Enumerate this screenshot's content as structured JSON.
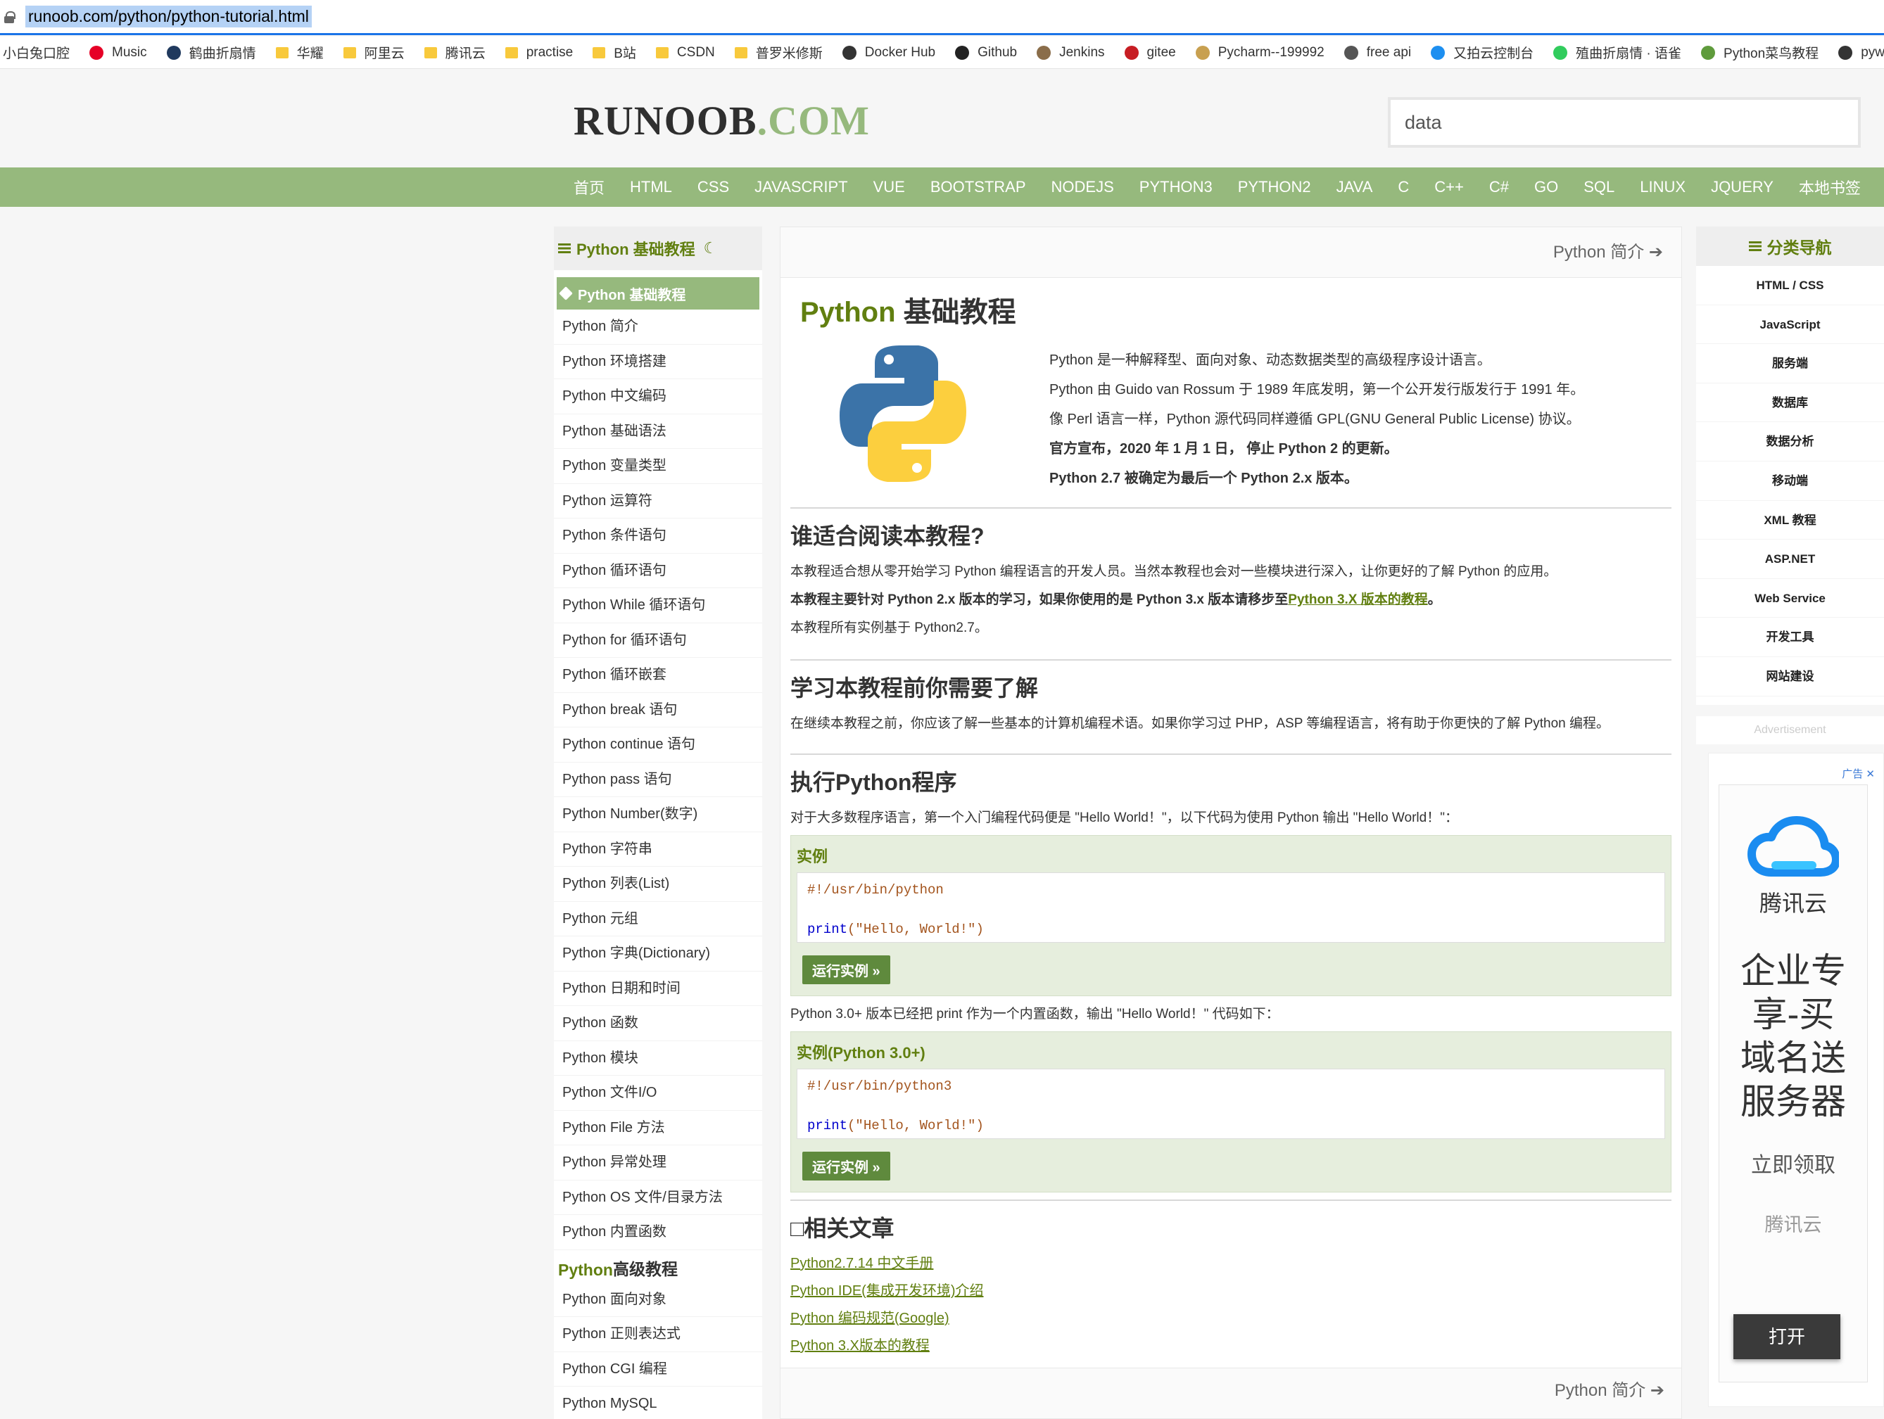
{
  "browser": {
    "url": "runoob.com/python/python-tutorial.html",
    "bookmarks": [
      {
        "label": "小白兔口腔",
        "icon": "none",
        "color": ""
      },
      {
        "label": "Music",
        "icon": "netease-music-icon",
        "color": "#e60026"
      },
      {
        "label": "鹤曲折扇情",
        "icon": "image-icon",
        "color": "#203a5e"
      },
      {
        "label": "华耀",
        "icon": "folder-icon",
        "color": "#f8c93c"
      },
      {
        "label": "阿里云",
        "icon": "folder-icon",
        "color": "#f8c93c"
      },
      {
        "label": "腾讯云",
        "icon": "folder-icon",
        "color": "#f8c93c"
      },
      {
        "label": "practise",
        "icon": "folder-icon",
        "color": "#f8c93c"
      },
      {
        "label": "B站",
        "icon": "folder-icon",
        "color": "#f8c93c"
      },
      {
        "label": "CSDN",
        "icon": "folder-icon",
        "color": "#f8c93c"
      },
      {
        "label": "普罗米修斯",
        "icon": "folder-icon",
        "color": "#f8c93c"
      },
      {
        "label": "Docker Hub",
        "icon": "docker-icon",
        "color": "#333333"
      },
      {
        "label": "Github",
        "icon": "github-icon",
        "color": "#222222"
      },
      {
        "label": "Jenkins",
        "icon": "jenkins-icon",
        "color": "#8a6d4a"
      },
      {
        "label": "gitee",
        "icon": "gitee-icon",
        "color": "#c71d23"
      },
      {
        "label": "Pycharm--199992",
        "icon": "user-icon",
        "color": "#c8a050"
      },
      {
        "label": "free api",
        "icon": "globe-icon",
        "color": "#555555"
      },
      {
        "label": "又拍云控制台",
        "icon": "upyun-icon",
        "color": "#1d8ff0"
      },
      {
        "label": "殖曲折扇情 · 语雀",
        "icon": "yuque-icon",
        "color": "#31cc5d"
      },
      {
        "label": "Python菜鸟教程",
        "icon": "runoob-icon",
        "color": "#5f9b3c"
      },
      {
        "label": "pywin",
        "icon": "pywin-icon",
        "color": "#333333"
      }
    ]
  },
  "header": {
    "logo_main": "RUNOOB",
    "logo_dot": ".COM",
    "search_value": "data"
  },
  "nav": [
    "首页",
    "HTML",
    "CSS",
    "JAVASCRIPT",
    "VUE",
    "BOOTSTRAP",
    "NODEJS",
    "PYTHON3",
    "PYTHON2",
    "JAVA",
    "C",
    "C++",
    "C#",
    "GO",
    "SQL",
    "LINUX",
    "JQUERY",
    "本地书签"
  ],
  "left_nav": {
    "head": "Python 基础教程",
    "active": "Python 基础教程",
    "items": [
      "Python 简介",
      "Python 环境搭建",
      "Python 中文编码",
      "Python 基础语法",
      "Python 变量类型",
      "Python 运算符",
      "Python 条件语句",
      "Python 循环语句",
      "Python While 循环语句",
      "Python for 循环语句",
      "Python 循环嵌套",
      "Python break 语句",
      "Python continue 语句",
      "Python pass 语句",
      "Python Number(数字)",
      "Python 字符串",
      "Python 列表(List)",
      "Python 元组",
      "Python 字典(Dictionary)",
      "Python 日期和时间",
      "Python 函数",
      "Python 模块",
      "Python 文件I/O",
      "Python File 方法",
      "Python 异常处理",
      "Python OS 文件/目录方法",
      "Python 内置函数"
    ],
    "advanced_head_green": "Python",
    "advanced_head_rest": " 高级教程",
    "advanced_items": [
      "Python 面向对象",
      "Python 正则表达式",
      "Python CGI 编程",
      "Python MySQL"
    ]
  },
  "main": {
    "next_link": "Python 简介",
    "title_green": "Python",
    "title_rest": " 基础教程",
    "intro": [
      "Python 是一种解释型、面向对象、动态数据类型的高级程序设计语言。",
      "Python 由 Guido van Rossum 于 1989 年底发明，第一个公开发行版发行于 1991 年。",
      "像 Perl 语言一样，Python 源代码同样遵循 GPL(GNU General Public License) 协议。",
      "官方宣布，2020 年 1 月 1 日， 停止 Python 2 的更新。",
      "Python 2.7 被确定为最后一个 Python 2.x 版本。"
    ],
    "s1_title": "谁适合阅读本教程?",
    "s1_p1": "本教程适合想从零开始学习 Python 编程语言的开发人员。当然本教程也会对一些模块进行深入，让你更好的了解 Python 的应用。",
    "s1_p2_pre": "本教程主要针对 Python 2.x 版本的学习，如果你使用的是 Python 3.x 版本请移步至",
    "s1_p2_link": "Python 3.X 版本的教程",
    "s1_p2_post": "。",
    "s1_p3": "本教程所有实例基于 Python2.7。",
    "s2_title": "学习本教程前你需要了解",
    "s2_p": "在继续本教程之前，你应该了解一些基本的计算机编程术语。如果你学习过 PHP，ASP 等编程语言，将有助于你更快的了解 Python 编程。",
    "s3_title": "执行Python程序",
    "s3_p": "对于大多数程序语言，第一个入门编程代码便是 \"Hello World！\"，以下代码为使用 Python 输出 \"Hello World！\"：",
    "ex1_title": "实例",
    "ex1_line1": "#!/usr/bin/python",
    "ex1_kw": "print",
    "ex1_args": "(\"Hello, World!\")",
    "run_label": "运行实例 »",
    "s3_p2": "Python 3.0+ 版本已经把 print 作为一个内置函数，输出 \"Hello World！\" 代码如下：",
    "ex2_title": "实例(Python 3.0+)",
    "ex2_line1": "#!/usr/bin/python3",
    "ex2_kw": "print",
    "ex2_args": "(\"Hello, World!\")",
    "related_title": "相关文章",
    "related": [
      "Python2.7.14 中文手册",
      "Python IDE(集成开发环境)介绍",
      "Python 编码规范(Google)",
      "Python 3.X版本的教程"
    ],
    "bottom_next": "Python 简介"
  },
  "right_nav": {
    "head": "分类导航",
    "items": [
      "HTML / CSS",
      "JavaScript",
      "服务端",
      "数据库",
      "数据分析",
      "移动端",
      "XML 教程",
      "ASP.NET",
      "Web Service",
      "开发工具",
      "网站建设"
    ],
    "advertisement": "Advertisement"
  },
  "ad": {
    "tag": "广告 ✕",
    "brand": "腾讯云",
    "slogan": [
      "企业专",
      "享-买",
      "域名送",
      "服务器"
    ],
    "sub": "立即领取",
    "sub2": "腾讯云",
    "button": "打开"
  },
  "colors": {
    "accent_green": "#96b97d",
    "text_green": "#617f10",
    "link_blue": "#1a73e8"
  }
}
